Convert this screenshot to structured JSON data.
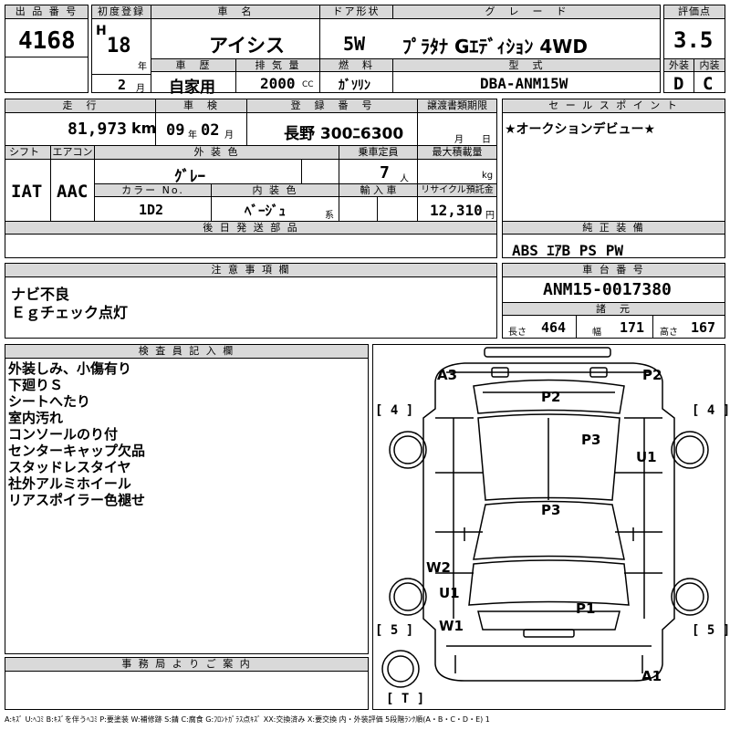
{
  "headers": {
    "lot": "出 品 番 号",
    "first_reg": "初度登録",
    "car_name": "車　名",
    "door": "ドア形状",
    "grade": "グ　レ　ー　ド",
    "score": "評価点",
    "inspection": "車　歴",
    "displacement": "排 気 量",
    "fuel": "燃　料",
    "model_code": "型　式",
    "exterior": "外装",
    "interior": "内装",
    "mileage": "走　行",
    "shaken": "車　検",
    "reg_number": "登　録　番　号",
    "transfer_docs": "譲渡書類期限",
    "sales_point": "セ ー ル ス ポ イ ン ト",
    "shift": "シフト",
    "aircon": "エアコン",
    "ext_color": "外 装 色",
    "capacity": "乗車定員",
    "max_load": "最大積載量",
    "color_no": "カラー No.",
    "int_color": "内 装 色",
    "import": "輸 入 車",
    "recycle": "リサイクル預託金",
    "later_parts": "後 日 発 送 部 品",
    "genuine_equip": "純 正 装 備",
    "notes": "注 意 事 項 欄",
    "chassis": "車 台 番 号",
    "specs": "諸　元",
    "inspector": "検 査 員 記 入 欄",
    "office": "事 務 局 よ り ご 案 内"
  },
  "lot_number": "4168",
  "first_reg": {
    "era": "H",
    "year": "18",
    "year_unit": "年",
    "month": "2",
    "month_unit": "月"
  },
  "car_name": "アイシス",
  "door": "5W",
  "grade": "ﾌﾟﾗﾀﾅ Gｴﾃﾞｨｼｮﾝ 4WD",
  "score": "3.5",
  "history": "自家用",
  "displacement": "2000",
  "displacement_unit": "CC",
  "fuel": "ｶﾞｿﾘﾝ",
  "model_code": "DBA-ANM15W",
  "exterior_grade": "D",
  "interior_grade": "C",
  "mileage": "81,973",
  "mileage_unit": "km",
  "shaken": {
    "year": "09",
    "year_unit": "年",
    "month": "02",
    "month_unit": "月"
  },
  "reg_number": "長野 300ﾆ6300",
  "transfer_docs": {
    "month_unit": "月",
    "day_unit": "日"
  },
  "sales_point": "★オークションデビュー★",
  "shift": "IAT",
  "aircon": "AAC",
  "ext_color": "ｸﾞﾚｰ",
  "capacity": "7",
  "capacity_unit": "人",
  "max_load_unit": "kg",
  "color_no": "1D2",
  "int_color": "ﾍﾞｰｼﾞｭ",
  "int_color_unit": "系",
  "recycle": "12,310",
  "recycle_unit": "円",
  "genuine_equip": "ABS ｴｱB PS PW",
  "notes": [
    "ナビ不良",
    "Ｅｇチェック点灯"
  ],
  "chassis_number": "ANM15-0017380",
  "specs": {
    "length_label": "長さ",
    "length": "464",
    "width_label": "幅",
    "width": "171",
    "height_label": "高さ",
    "height": "167"
  },
  "inspector_notes": [
    "外装しみ、小傷有り",
    "下廻りＳ",
    "シートへたり",
    "室内汚れ",
    "コンソールのり付",
    "センターキャップ欠品",
    "スタッドレスタイヤ",
    "社外アルミホイール",
    "リアスポイラー色褪せ"
  ],
  "diagram": {
    "tire_front_left": "4",
    "tire_front_right": "4",
    "tire_rear_left": "5",
    "tire_rear_right": "5",
    "tire_spare": "T",
    "marks": [
      "A3",
      "P2",
      "P2",
      "P3",
      "U1",
      "P3",
      "W2",
      "U1",
      "W1",
      "P1",
      "A1"
    ]
  },
  "legend": "A:ｷｽﾞ U:ﾍｺﾐ B:ｷｽﾞを伴うﾍｺﾐ P:要塗装 W:補修跡 S:錆 C:腐食 G:ﾌﾛﾝﾄｶﾞﾗｽ点ｷｽﾞ XX:交換済み X:要交換 内・外装評価 5段階ﾗﾝｸ順(A・B・C・D・E) 1"
}
